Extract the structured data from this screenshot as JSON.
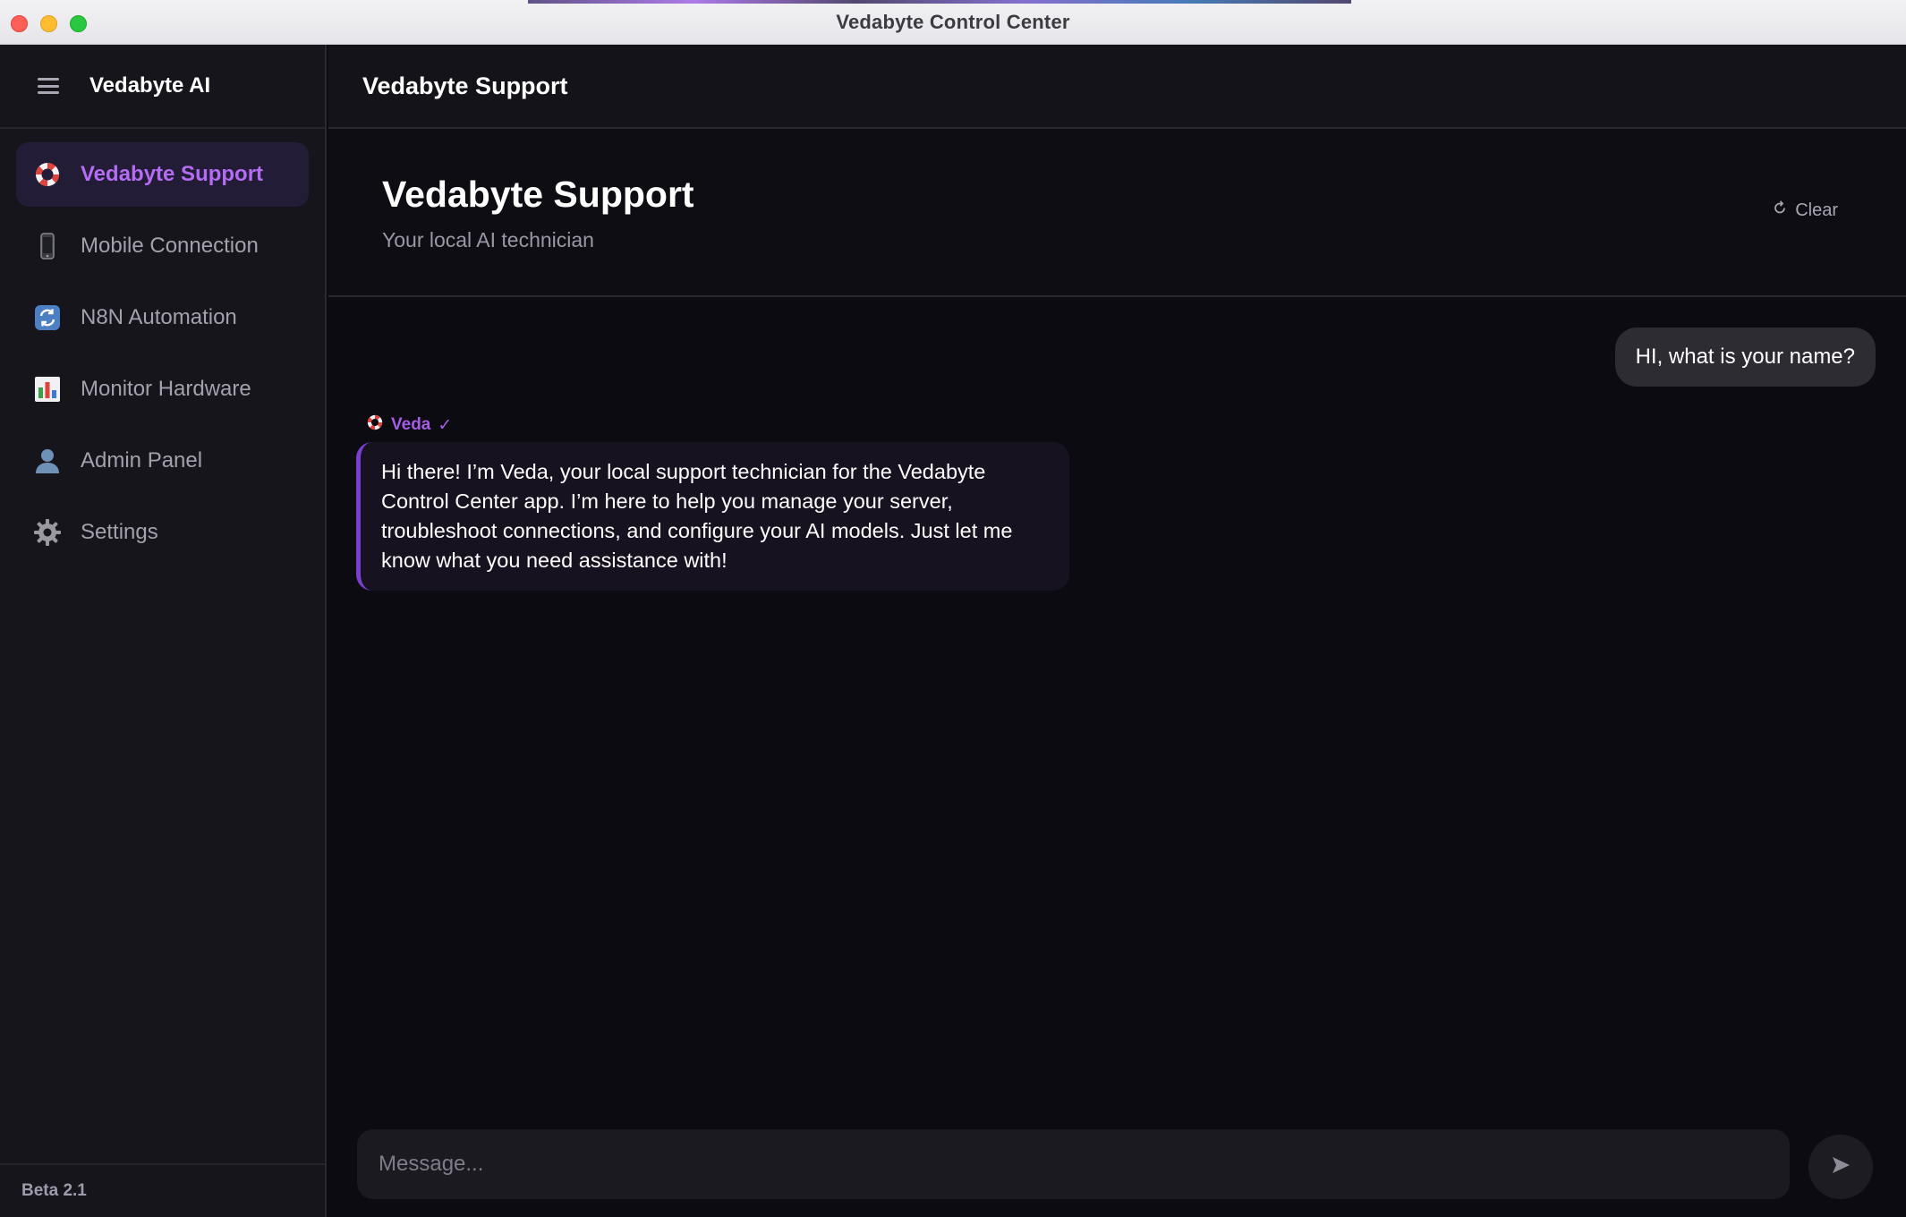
{
  "window": {
    "title": "Vedabyte Control Center"
  },
  "sidebar": {
    "brand": "Vedabyte AI",
    "items": [
      {
        "label": "Vedabyte Support",
        "icon": "lifebuoy-icon",
        "active": true
      },
      {
        "label": "Mobile Connection",
        "icon": "mobile-phone-icon",
        "active": false
      },
      {
        "label": "N8N Automation",
        "icon": "refresh-cycle-icon",
        "active": false
      },
      {
        "label": "Monitor Hardware",
        "icon": "bar-chart-icon",
        "active": false
      },
      {
        "label": "Admin Panel",
        "icon": "user-icon",
        "active": false
      },
      {
        "label": "Settings",
        "icon": "gear-icon",
        "active": false
      }
    ],
    "version": "Beta 2.1"
  },
  "main": {
    "topbar_title": "Vedabyte Support",
    "hero": {
      "title": "Vedabyte Support",
      "subtitle": "Your local AI technician",
      "clear_label": "Clear"
    },
    "messages": {
      "user": "HI, what is your name?",
      "assistant_name": "Veda",
      "assistant_verified": "✓",
      "assistant": "Hi there! I’m Veda, your local support technician for the Vedabyte Control Center app. I’m here to help you manage your server, troubleshoot connections, and configure your AI models. Just let me know what you need assistance with!"
    },
    "composer": {
      "placeholder": "Message..."
    }
  },
  "colors": {
    "accent": "#b36cf2",
    "accent_border": "#7b3fd0",
    "sidebar_bg": "#16151c",
    "main_bg": "#0c0b11"
  }
}
